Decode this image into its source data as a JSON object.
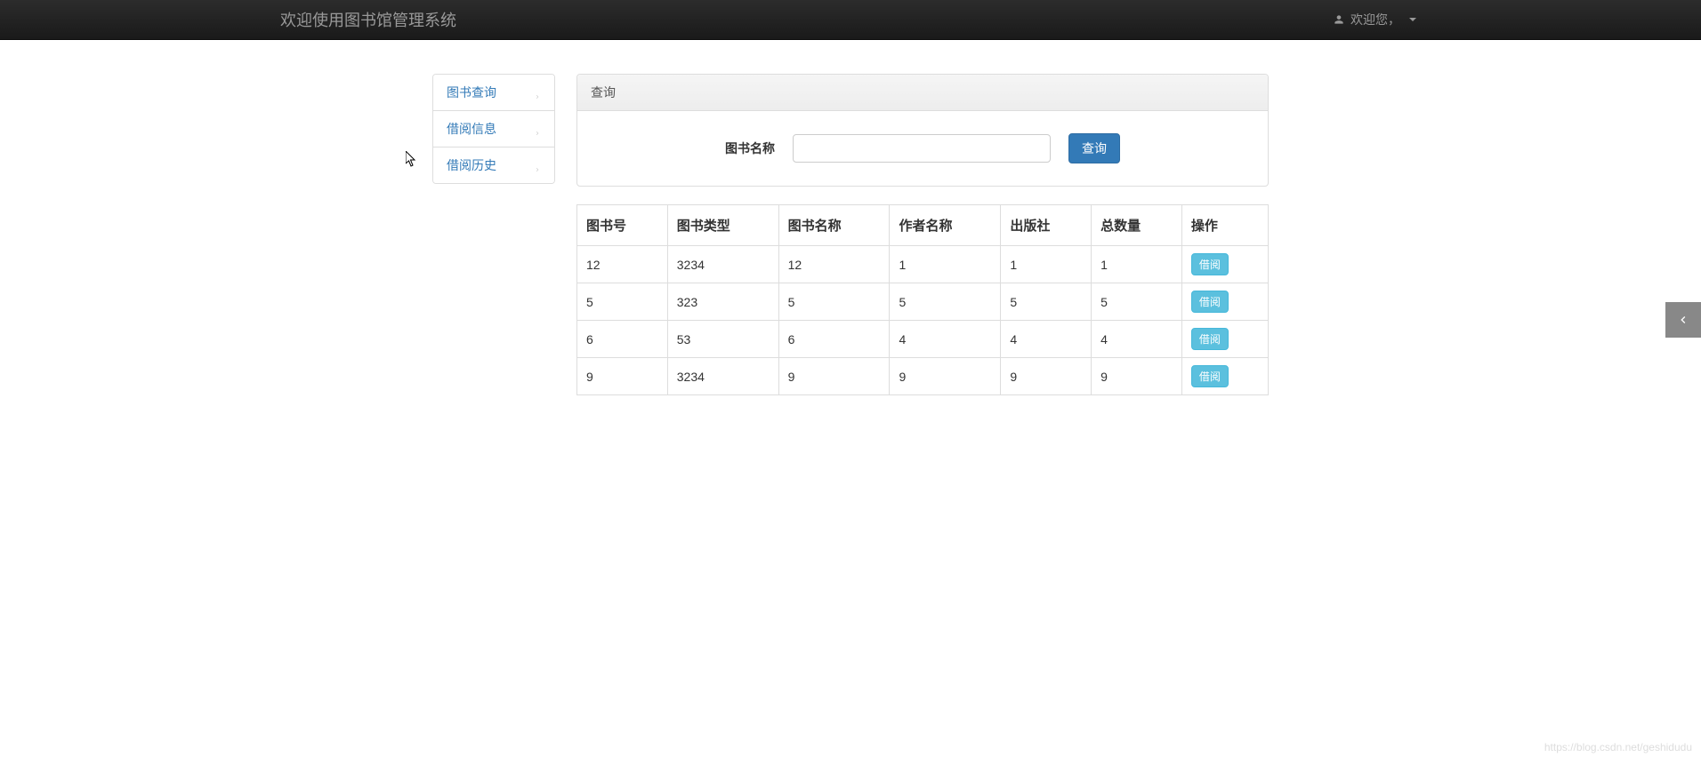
{
  "navbar": {
    "brand": "欢迎使用图书馆管理系统",
    "user_greeting": "欢迎您，"
  },
  "sidebar": {
    "items": [
      {
        "label": "图书查询",
        "active": true
      },
      {
        "label": "借阅信息",
        "active": false
      },
      {
        "label": "借阅历史",
        "active": false
      }
    ]
  },
  "search_panel": {
    "title": "查询",
    "label": "图书名称",
    "input_value": "",
    "button_label": "查询"
  },
  "table": {
    "headers": [
      "图书号",
      "图书类型",
      "图书名称",
      "作者名称",
      "出版社",
      "总数量",
      "操作"
    ],
    "action_label": "借阅",
    "rows": [
      {
        "book_id": "12",
        "book_type": "3234",
        "book_name": "12",
        "author": "1",
        "publisher": "1",
        "total": "1"
      },
      {
        "book_id": "5",
        "book_type": "323",
        "book_name": "5",
        "author": "5",
        "publisher": "5",
        "total": "5"
      },
      {
        "book_id": "6",
        "book_type": "53",
        "book_name": "6",
        "author": "4",
        "publisher": "4",
        "total": "4"
      },
      {
        "book_id": "9",
        "book_type": "3234",
        "book_name": "9",
        "author": "9",
        "publisher": "9",
        "total": "9"
      }
    ]
  },
  "watermark": "https://blog.csdn.net/geshidudu"
}
